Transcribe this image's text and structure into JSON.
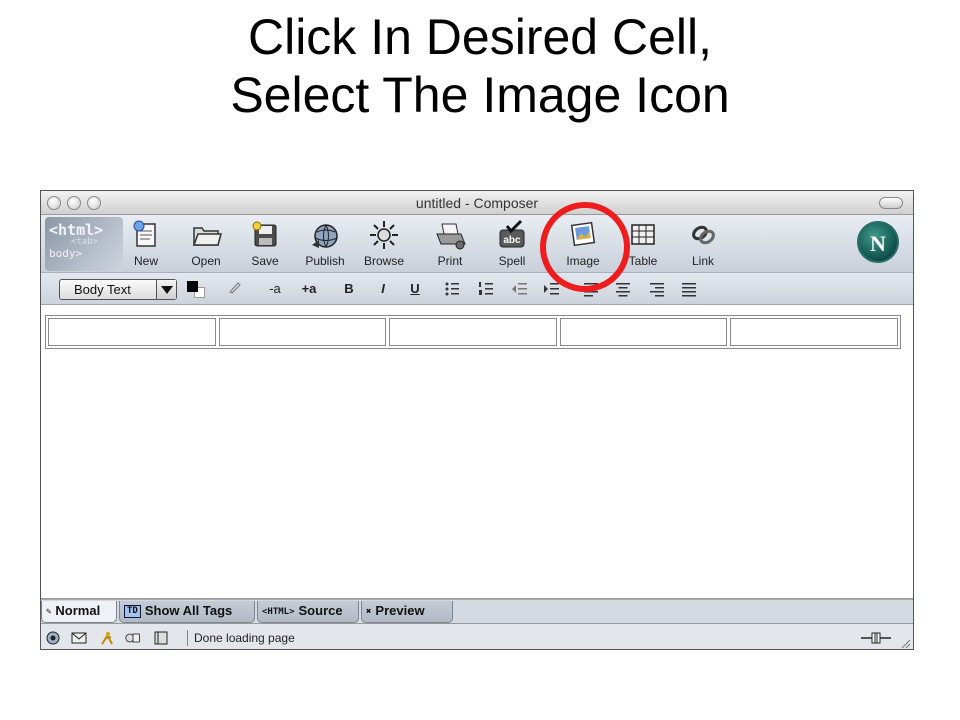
{
  "slide": {
    "title_line1": "Click In Desired Cell,",
    "title_line2": "Select The Image Icon"
  },
  "window": {
    "title": "untitled - Composer"
  },
  "toolbar": {
    "items": [
      {
        "label": "New",
        "icon": "new-document-icon"
      },
      {
        "label": "Open",
        "icon": "folder-icon"
      },
      {
        "label": "Save",
        "icon": "disk-icon"
      },
      {
        "label": "Publish",
        "icon": "globe-publish-icon"
      },
      {
        "label": "Browse",
        "icon": "compass-icon"
      },
      {
        "label": "Print",
        "icon": "printer-icon"
      },
      {
        "label": "Spell",
        "icon": "spellcheck-icon"
      },
      {
        "label": "Image",
        "icon": "image-icon"
      },
      {
        "label": "Table",
        "icon": "table-icon"
      },
      {
        "label": "Link",
        "icon": "link-icon"
      }
    ],
    "badge_html": "<html>",
    "badge_body": "body>",
    "badge_mid": "<tab>",
    "brand_letter": "N"
  },
  "format": {
    "paragraph_style": "Body Text",
    "smaller_label": "-a",
    "larger_label": "+a",
    "bold_label": "B",
    "italic_label": "I",
    "underline_label": "U"
  },
  "tabs": [
    {
      "label": "Normal",
      "active": true
    },
    {
      "label": "Show All Tags",
      "active": false,
      "badge": "TD"
    },
    {
      "label": "Source",
      "active": false,
      "badge": "<HTML>"
    },
    {
      "label": "Preview",
      "active": false
    }
  ],
  "status": {
    "text": "Done loading page"
  },
  "colors": {
    "highlight": "#ee1c1c",
    "toolbar_bg": "#dfe3ea"
  }
}
